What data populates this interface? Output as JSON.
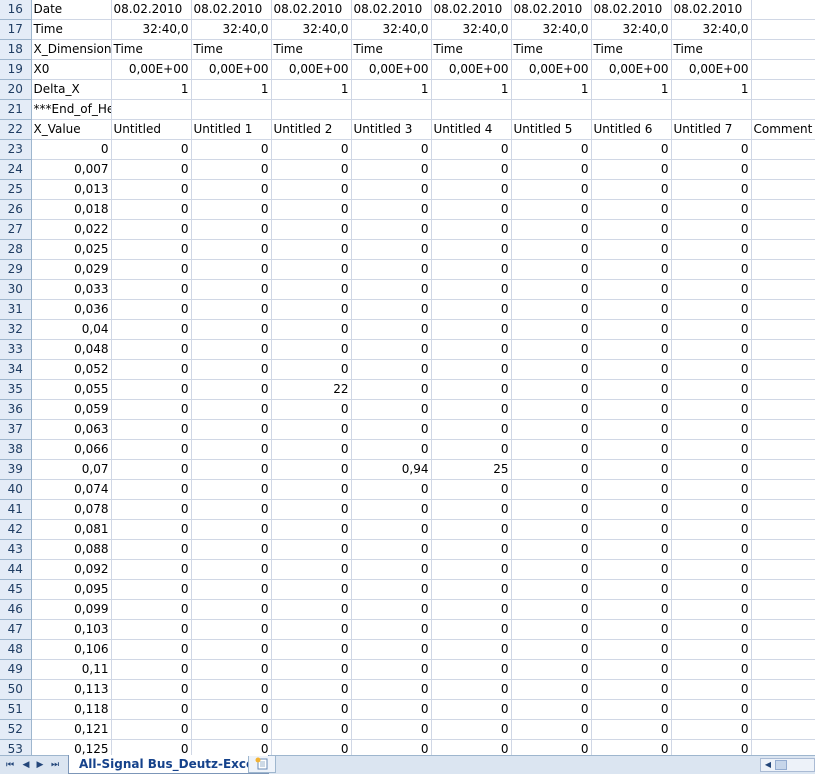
{
  "header_rows": [
    {
      "num": "16",
      "cells": [
        "Date",
        "08.02.2010",
        "08.02.2010",
        "08.02.2010",
        "08.02.2010",
        "08.02.2010",
        "08.02.2010",
        "08.02.2010",
        "08.02.2010",
        ""
      ]
    },
    {
      "num": "17",
      "cells": [
        "Time",
        "32:40,0",
        "32:40,0",
        "32:40,0",
        "32:40,0",
        "32:40,0",
        "32:40,0",
        "32:40,0",
        "32:40,0",
        ""
      ]
    },
    {
      "num": "18",
      "cells": [
        "X_Dimension",
        "Time",
        "Time",
        "Time",
        "Time",
        "Time",
        "Time",
        "Time",
        "Time",
        ""
      ]
    },
    {
      "num": "19",
      "cells": [
        "X0",
        "0,00E+00",
        "0,00E+00",
        "0,00E+00",
        "0,00E+00",
        "0,00E+00",
        "0,00E+00",
        "0,00E+00",
        "0,00E+00",
        ""
      ]
    },
    {
      "num": "20",
      "cells": [
        "Delta_X",
        "1",
        "1",
        "1",
        "1",
        "1",
        "1",
        "1",
        "1",
        ""
      ]
    },
    {
      "num": "21",
      "cells": [
        "***End_of_Header***",
        "",
        "",
        "",
        "",
        "",
        "",
        "",
        "",
        ""
      ]
    },
    {
      "num": "22",
      "cells": [
        "X_Value",
        "Untitled",
        "Untitled 1",
        "Untitled 2",
        "Untitled 3",
        "Untitled 4",
        "Untitled 5",
        "Untitled 6",
        "Untitled 7",
        "Comment"
      ]
    }
  ],
  "data_rows": [
    {
      "num": "23",
      "cells": [
        "0",
        "0",
        "0",
        "0",
        "0",
        "0",
        "0",
        "0",
        "0",
        ""
      ]
    },
    {
      "num": "24",
      "cells": [
        "0,007",
        "0",
        "0",
        "0",
        "0",
        "0",
        "0",
        "0",
        "0",
        ""
      ]
    },
    {
      "num": "25",
      "cells": [
        "0,013",
        "0",
        "0",
        "0",
        "0",
        "0",
        "0",
        "0",
        "0",
        ""
      ]
    },
    {
      "num": "26",
      "cells": [
        "0,018",
        "0",
        "0",
        "0",
        "0",
        "0",
        "0",
        "0",
        "0",
        ""
      ]
    },
    {
      "num": "27",
      "cells": [
        "0,022",
        "0",
        "0",
        "0",
        "0",
        "0",
        "0",
        "0",
        "0",
        ""
      ]
    },
    {
      "num": "28",
      "cells": [
        "0,025",
        "0",
        "0",
        "0",
        "0",
        "0",
        "0",
        "0",
        "0",
        ""
      ]
    },
    {
      "num": "29",
      "cells": [
        "0,029",
        "0",
        "0",
        "0",
        "0",
        "0",
        "0",
        "0",
        "0",
        ""
      ]
    },
    {
      "num": "30",
      "cells": [
        "0,033",
        "0",
        "0",
        "0",
        "0",
        "0",
        "0",
        "0",
        "0",
        ""
      ]
    },
    {
      "num": "31",
      "cells": [
        "0,036",
        "0",
        "0",
        "0",
        "0",
        "0",
        "0",
        "0",
        "0",
        ""
      ]
    },
    {
      "num": "32",
      "cells": [
        "0,04",
        "0",
        "0",
        "0",
        "0",
        "0",
        "0",
        "0",
        "0",
        ""
      ]
    },
    {
      "num": "33",
      "cells": [
        "0,048",
        "0",
        "0",
        "0",
        "0",
        "0",
        "0",
        "0",
        "0",
        ""
      ]
    },
    {
      "num": "34",
      "cells": [
        "0,052",
        "0",
        "0",
        "0",
        "0",
        "0",
        "0",
        "0",
        "0",
        ""
      ]
    },
    {
      "num": "35",
      "cells": [
        "0,055",
        "0",
        "0",
        "22",
        "0",
        "0",
        "0",
        "0",
        "0",
        ""
      ]
    },
    {
      "num": "36",
      "cells": [
        "0,059",
        "0",
        "0",
        "0",
        "0",
        "0",
        "0",
        "0",
        "0",
        ""
      ]
    },
    {
      "num": "37",
      "cells": [
        "0,063",
        "0",
        "0",
        "0",
        "0",
        "0",
        "0",
        "0",
        "0",
        ""
      ]
    },
    {
      "num": "38",
      "cells": [
        "0,066",
        "0",
        "0",
        "0",
        "0",
        "0",
        "0",
        "0",
        "0",
        ""
      ]
    },
    {
      "num": "39",
      "cells": [
        "0,07",
        "0",
        "0",
        "0",
        "0,94",
        "25",
        "0",
        "0",
        "0",
        ""
      ]
    },
    {
      "num": "40",
      "cells": [
        "0,074",
        "0",
        "0",
        "0",
        "0",
        "0",
        "0",
        "0",
        "0",
        ""
      ]
    },
    {
      "num": "41",
      "cells": [
        "0,078",
        "0",
        "0",
        "0",
        "0",
        "0",
        "0",
        "0",
        "0",
        ""
      ]
    },
    {
      "num": "42",
      "cells": [
        "0,081",
        "0",
        "0",
        "0",
        "0",
        "0",
        "0",
        "0",
        "0",
        ""
      ]
    },
    {
      "num": "43",
      "cells": [
        "0,088",
        "0",
        "0",
        "0",
        "0",
        "0",
        "0",
        "0",
        "0",
        ""
      ]
    },
    {
      "num": "44",
      "cells": [
        "0,092",
        "0",
        "0",
        "0",
        "0",
        "0",
        "0",
        "0",
        "0",
        ""
      ]
    },
    {
      "num": "45",
      "cells": [
        "0,095",
        "0",
        "0",
        "0",
        "0",
        "0",
        "0",
        "0",
        "0",
        ""
      ]
    },
    {
      "num": "46",
      "cells": [
        "0,099",
        "0",
        "0",
        "0",
        "0",
        "0",
        "0",
        "0",
        "0",
        ""
      ]
    },
    {
      "num": "47",
      "cells": [
        "0,103",
        "0",
        "0",
        "0",
        "0",
        "0",
        "0",
        "0",
        "0",
        ""
      ]
    },
    {
      "num": "48",
      "cells": [
        "0,106",
        "0",
        "0",
        "0",
        "0",
        "0",
        "0",
        "0",
        "0",
        ""
      ]
    },
    {
      "num": "49",
      "cells": [
        "0,11",
        "0",
        "0",
        "0",
        "0",
        "0",
        "0",
        "0",
        "0",
        ""
      ]
    },
    {
      "num": "50",
      "cells": [
        "0,113",
        "0",
        "0",
        "0",
        "0",
        "0",
        "0",
        "0",
        "0",
        ""
      ]
    },
    {
      "num": "51",
      "cells": [
        "0,118",
        "0",
        "0",
        "0",
        "0",
        "0",
        "0",
        "0",
        "0",
        ""
      ]
    },
    {
      "num": "52",
      "cells": [
        "0,121",
        "0",
        "0",
        "0",
        "0",
        "0",
        "0",
        "0",
        "0",
        ""
      ]
    },
    {
      "num": "53",
      "cells": [
        "0,125",
        "0",
        "0",
        "0",
        "0",
        "0",
        "0",
        "0",
        "0",
        ""
      ]
    }
  ],
  "sheet_tabs": {
    "active_label": "All-Signal Bus_Deutz-Excel",
    "nav_icons": [
      "first-sheet-icon",
      "prev-sheet-icon",
      "next-sheet-icon",
      "last-sheet-icon"
    ],
    "insert_icon": "insert-sheet-icon"
  },
  "colors": {
    "grid_line": "#d0d7e5",
    "row_header_bg": "#e4ecf7",
    "status_bar_bg": "#dbe5f1",
    "tab_text": "#15428b"
  }
}
